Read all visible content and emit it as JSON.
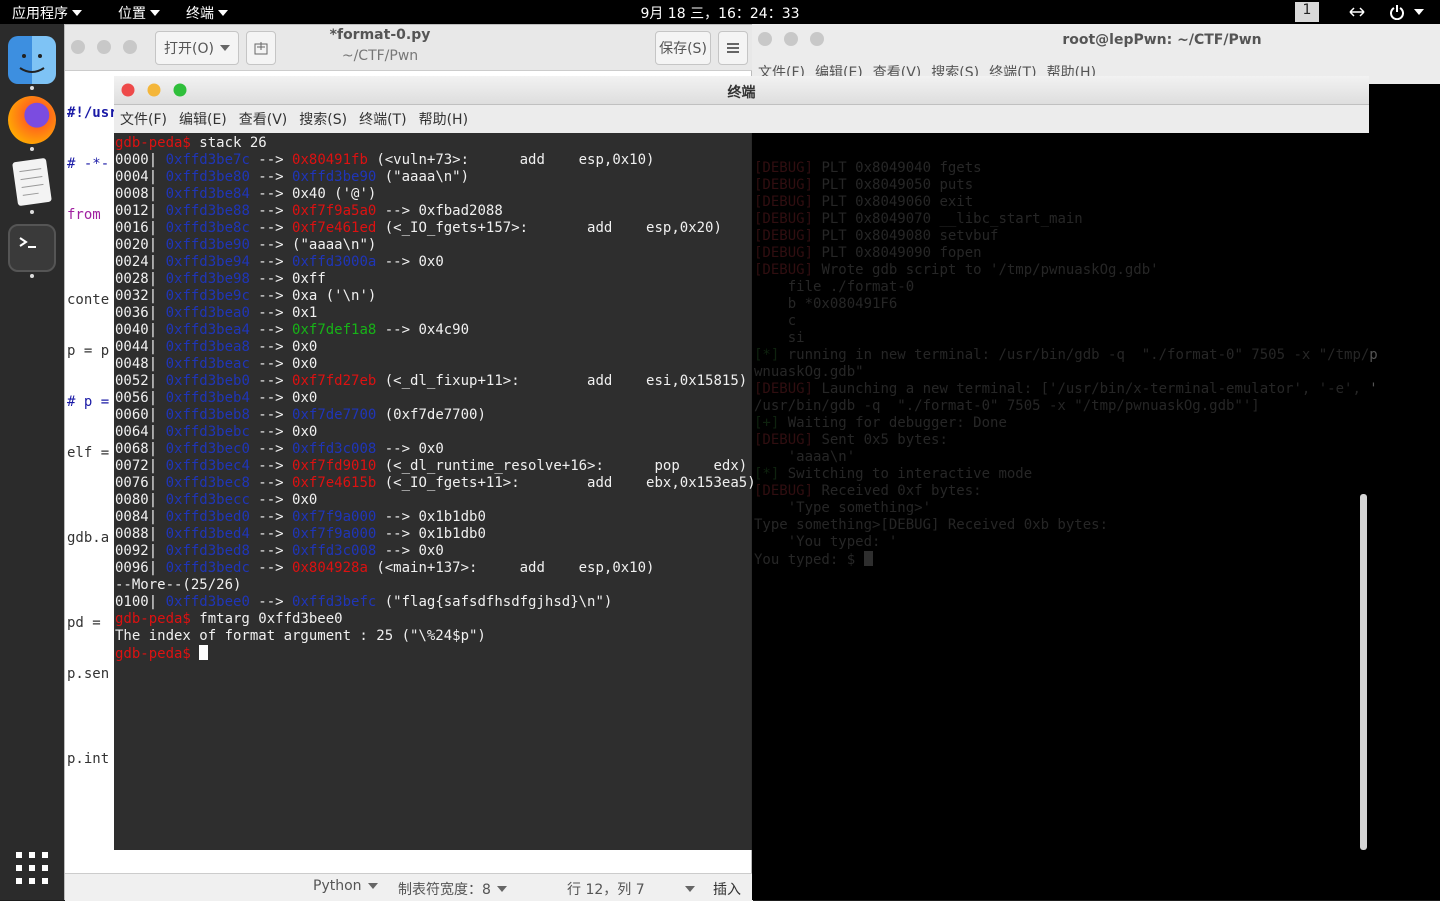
{
  "topbar": {
    "apps": "应用程序",
    "places": "位置",
    "terminal": "终端",
    "clock": "9月 18 三，16：24：33",
    "workspace": "1"
  },
  "gedit": {
    "open_label": "打开(O)",
    "title": "*format-0.py",
    "subtitle": "~/CTF/Pwn",
    "save_label": "保存(S)",
    "code_lines": [
      "#!/usr",
      "# -*-",
      "from ",
      "",
      "conte",
      "p = p",
      "# p =",
      "elf =",
      "",
      "gdb.a",
      "",
      "pd = ",
      "p.sen",
      "",
      "p.int"
    ],
    "status": {
      "language": "Python",
      "tab_width": "制表符宽度：8",
      "position": "行 12，列 7",
      "mode": "插入"
    }
  },
  "back_terminal": {
    "title": "root@lepPwn: ~/CTF/Pwn",
    "menu": [
      "文件(F)",
      "编辑(E)",
      "查看(V)",
      "搜索(S)",
      "终端(T)",
      "帮助(H)"
    ],
    "lines": [
      "[DEBUG] PLT 0x8049040 fgets",
      "[DEBUG] PLT 0x8049050 puts",
      "[DEBUG] PLT 0x8049060 exit",
      "[DEBUG] PLT 0x8049070 __libc_start_main",
      "[DEBUG] PLT 0x8049080 setvbuf",
      "[DEBUG] PLT 0x8049090 fopen",
      "[DEBUG] Wrote gdb script to '/tmp/pwnuaskOg.gdb'",
      "    file ./format-0",
      "    b *0x080491F6",
      "    c",
      "    si",
      "[*] running in new terminal: /usr/bin/gdb -q  \"./format-0\" 7505 -x \"/tmp/p",
      "wnuaskOg.gdb\"",
      "[DEBUG] Launching a new terminal: ['/usr/bin/x-terminal-emulator', '-e', '",
      "/usr/bin/gdb -q  \"./format-0\" 7505 -x \"/tmp/pwnuaskOg.gdb\"']",
      "[+] Waiting for debugger: Done",
      "[DEBUG] Sent 0x5 bytes:",
      "    'aaaa\\n'",
      "[*] Switching to interactive mode",
      "[DEBUG] Received 0xf bytes:",
      "    'Type something>'",
      "Type something>[DEBUG] Received 0xb bytes:",
      "    'You typed: '",
      "You typed: $ "
    ]
  },
  "front_terminal": {
    "title": "终端",
    "menu": [
      "文件(F)",
      "编辑(E)",
      "查看(V)",
      "搜索(S)",
      "终端(T)",
      "帮助(H)"
    ],
    "prompt": "gdb-peda$",
    "cmd1": " stack 26",
    "stack": [
      {
        "off": "0000|",
        "addr": "0xffd3be7c",
        "val": "0x80491fb",
        "vc": "r",
        "rest": " (<vuln+73>:      add    esp,0x10)"
      },
      {
        "off": "0004|",
        "addr": "0xffd3be80",
        "val": "0xffd3be90",
        "vc": "a",
        "rest": " (\"aaaa\\n\")"
      },
      {
        "off": "0008|",
        "addr": "0xffd3be84",
        "val": "",
        "vc": "",
        "rest": "0x40 ('@')"
      },
      {
        "off": "0012|",
        "addr": "0xffd3be88",
        "val": "0xf7f9a5a0",
        "vc": "r",
        "rest": " --> 0xfbad2088"
      },
      {
        "off": "0016|",
        "addr": "0xffd3be8c",
        "val": "0xf7e461ed",
        "vc": "r",
        "rest": " (<_IO_fgets+157>:       add    esp,0x20)"
      },
      {
        "off": "0020|",
        "addr": "0xffd3be90",
        "val": "",
        "vc": "",
        "rest": "(\"aaaa\\n\")"
      },
      {
        "off": "0024|",
        "addr": "0xffd3be94",
        "val": "0xffd3000a",
        "vc": "a",
        "rest": " --> 0x0"
      },
      {
        "off": "0028|",
        "addr": "0xffd3be98",
        "val": "",
        "vc": "",
        "rest": "0xff"
      },
      {
        "off": "0032|",
        "addr": "0xffd3be9c",
        "val": "",
        "vc": "",
        "rest": "0xa ('\\n')"
      },
      {
        "off": "0036|",
        "addr": "0xffd3bea0",
        "val": "",
        "vc": "",
        "rest": "0x1"
      },
      {
        "off": "0040|",
        "addr": "0xffd3bea4",
        "val": "0xf7def1a8",
        "vc": "g",
        "rest": " --> 0x4c90"
      },
      {
        "off": "0044|",
        "addr": "0xffd3bea8",
        "val": "",
        "vc": "",
        "rest": "0x0"
      },
      {
        "off": "0048|",
        "addr": "0xffd3beac",
        "val": "",
        "vc": "",
        "rest": "0x0"
      },
      {
        "off": "0052|",
        "addr": "0xffd3beb0",
        "val": "0xf7fd27eb",
        "vc": "r",
        "rest": " (<_dl_fixup+11>:        add    esi,0x15815)"
      },
      {
        "off": "0056|",
        "addr": "0xffd3beb4",
        "val": "",
        "vc": "",
        "rest": "0x0"
      },
      {
        "off": "0060|",
        "addr": "0xffd3beb8",
        "val": "0xf7de7700",
        "vc": "a",
        "rest": " (0xf7de7700)"
      },
      {
        "off": "0064|",
        "addr": "0xffd3bebc",
        "val": "",
        "vc": "",
        "rest": "0x0"
      },
      {
        "off": "0068|",
        "addr": "0xffd3bec0",
        "val": "0xffd3c008",
        "vc": "a",
        "rest": " --> 0x0"
      },
      {
        "off": "0072|",
        "addr": "0xffd3bec4",
        "val": "0xf7fd9010",
        "vc": "r",
        "rest": " (<_dl_runtime_resolve+16>:      pop    edx)"
      },
      {
        "off": "0076|",
        "addr": "0xffd3bec8",
        "val": "0xf7e4615b",
        "vc": "r",
        "rest": " (<_IO_fgets+11>:        add    ebx,0x153ea5)"
      },
      {
        "off": "0080|",
        "addr": "0xffd3becc",
        "val": "",
        "vc": "",
        "rest": "0x0"
      },
      {
        "off": "0084|",
        "addr": "0xffd3bed0",
        "val": "0xf7f9a000",
        "vc": "a",
        "rest": " --> 0x1b1db0"
      },
      {
        "off": "0088|",
        "addr": "0xffd3bed4",
        "val": "0xf7f9a000",
        "vc": "a",
        "rest": " --> 0x1b1db0"
      },
      {
        "off": "0092|",
        "addr": "0xffd3bed8",
        "val": "0xffd3c008",
        "vc": "a",
        "rest": " --> 0x0"
      },
      {
        "off": "0096|",
        "addr": "0xffd3bedc",
        "val": "0x804928a",
        "vc": "r",
        "rest": " (<main+137>:     add    esp,0x10)"
      }
    ],
    "more": "--More--(25/26)",
    "last": {
      "off": "0100|",
      "addr": "0xffd3bee0",
      "val": "0xffd3befc",
      "vc": "a",
      "rest": " (\"flag{safsdfhsdfgjhsd}\\n\")"
    },
    "cmd2": " fmtarg 0xffd3bee0",
    "result": "The index of format argument : 25 (\"\\%24$p\")"
  },
  "colors": {
    "prompt": "#dd1111",
    "address": "#1f35b8",
    "code_ptr": "#dd1111",
    "libc_data": "#17b317"
  }
}
